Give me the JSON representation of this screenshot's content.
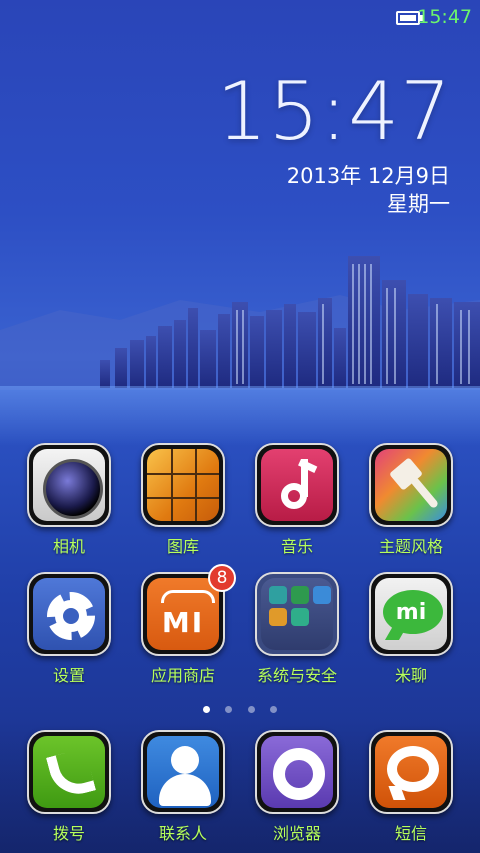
{
  "status_bar": {
    "time": "15:47",
    "battery_icon": "battery-icon",
    "time_color": "#6cf56c"
  },
  "clock": {
    "time": "15:47",
    "date": "2013年 12月9日",
    "weekday": "星期一"
  },
  "page_indicator": {
    "count": 4,
    "active": 0
  },
  "apps_row1": [
    {
      "label": "相机",
      "icon": "camera-icon"
    },
    {
      "label": "图库",
      "icon": "gallery-icon"
    },
    {
      "label": "音乐",
      "icon": "music-icon"
    },
    {
      "label": "主题风格",
      "icon": "theme-brush-icon"
    }
  ],
  "apps_row2": [
    {
      "label": "设置",
      "icon": "gear-icon"
    },
    {
      "label": "应用商店",
      "icon": "mi-store-icon",
      "badge": "8"
    },
    {
      "label": "系统与安全",
      "icon": "folder-icon"
    },
    {
      "label": "米聊",
      "icon": "mi-chat-icon"
    }
  ],
  "dock": [
    {
      "label": "拨号",
      "icon": "phone-icon"
    },
    {
      "label": "联系人",
      "icon": "contacts-icon"
    },
    {
      "label": "浏览器",
      "icon": "browser-icon"
    },
    {
      "label": "短信",
      "icon": "sms-icon"
    }
  ],
  "colors": {
    "label": "#b6ff5c",
    "badge": "#e23b2e"
  }
}
